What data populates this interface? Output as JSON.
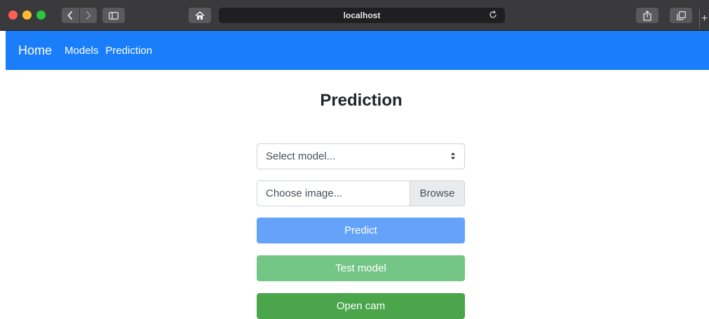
{
  "browser": {
    "address": "localhost",
    "colors": {
      "chrome": "#3a3a3c",
      "close": "#ff5f57",
      "minimize": "#febc2e",
      "zoom": "#28c840"
    }
  },
  "navbar": {
    "brand": "Home",
    "links": [
      "Models",
      "Prediction"
    ],
    "color": "#1a7efb"
  },
  "main": {
    "title": "Prediction",
    "model_select": {
      "selected": "Select model..."
    },
    "image_input": {
      "placeholder": "Choose image...",
      "browse_label": "Browse"
    },
    "buttons": {
      "predict": "Predict",
      "test_model": "Test model",
      "open_cam": "Open cam"
    },
    "colors": {
      "predict": "#65a3fb",
      "test_model": "#74c686",
      "open_cam": "#4aa54b"
    }
  },
  "icons": {
    "back": "chevron-left-icon",
    "forward": "chevron-right-icon",
    "sidebar": "sidebar-icon",
    "home": "home-icon",
    "reload": "reload-icon",
    "share": "share-icon",
    "tabs": "tabs-icon",
    "select_arrow": "select-arrows-icon"
  }
}
